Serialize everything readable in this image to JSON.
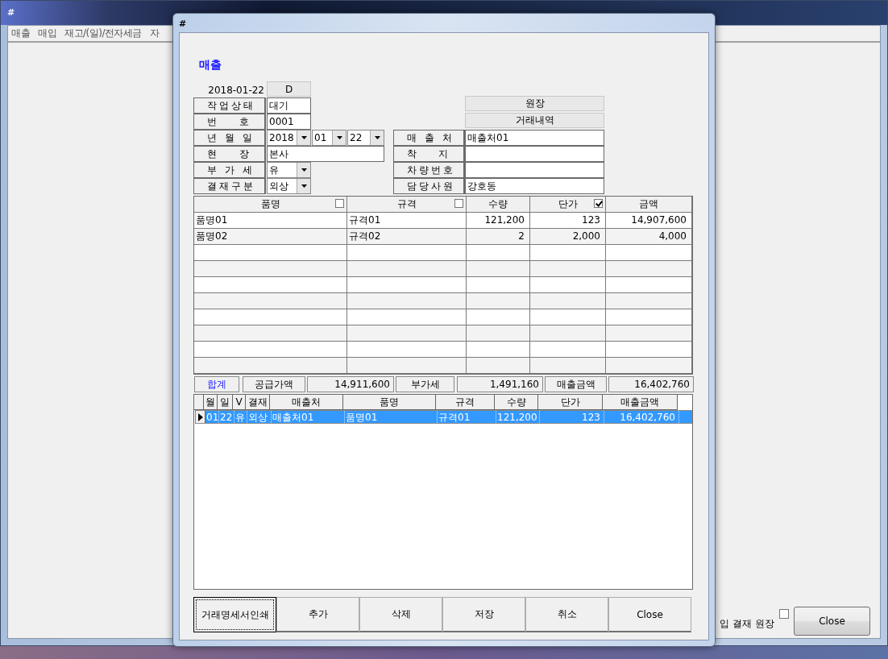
{
  "main_window": {
    "title": "#",
    "menu": [
      "매출",
      "매입",
      "재고/(일)/전자세금",
      "자"
    ],
    "option_label": "입 결재 원장",
    "option_checked": false,
    "close_button": "Close"
  },
  "dialog": {
    "title": "#",
    "heading": "매출",
    "date": "2018-01-22",
    "date_button": "D",
    "left_fields": [
      {
        "label": "작업상태",
        "kind": "text",
        "value": "대기"
      },
      {
        "label": "번 호",
        "kind": "text",
        "value": "0001"
      },
      {
        "label": "년 월 일",
        "kind": "date",
        "parts": [
          "2018",
          "01",
          "22"
        ]
      },
      {
        "label": "현 장",
        "kind": "wide",
        "value": "본사"
      },
      {
        "label": "부 가 세",
        "kind": "select",
        "value": "유"
      },
      {
        "label": "결재구분",
        "kind": "select",
        "value": "외상"
      }
    ],
    "right_buttons": [
      "원장",
      "거래내역"
    ],
    "right_fields": [
      {
        "label": "매 출 처",
        "value": "매출처01"
      },
      {
        "label": "착 지"
      },
      {
        "label": "차량번호"
      },
      {
        "label": "담당사원",
        "value": "강호동"
      }
    ],
    "grid": {
      "columns": [
        {
          "label": "품명",
          "kind": "check",
          "checked": false
        },
        {
          "label": "규격",
          "kind": "check",
          "checked": false
        },
        {
          "label": "수량",
          "kind": "plain"
        },
        {
          "label": "단가",
          "kind": "check",
          "checked": true
        },
        {
          "label": "금액",
          "kind": "plain"
        }
      ],
      "rows": [
        [
          "품명01",
          "규격01",
          "121,200",
          "123",
          "14,907,600"
        ],
        [
          "품명02",
          "규격02",
          "2",
          "2,000",
          "4,000"
        ]
      ]
    },
    "totals": {
      "label": "합계",
      "items": [
        {
          "label": "공급가액",
          "value": "14,911,600"
        },
        {
          "label": "부가세",
          "value": "1,491,160"
        },
        {
          "label": "매출금액",
          "value": "16,402,760"
        }
      ]
    },
    "list": {
      "columns": [
        "월",
        "일",
        "V",
        "결재",
        "매출처",
        "품명",
        "규격",
        "수량",
        "단가",
        "매출금액"
      ],
      "rows": [
        {
          "selected": true,
          "cells": [
            "01",
            "22",
            "유",
            "외상",
            "매출처01",
            "품명01",
            "규격01",
            "121,200",
            "123",
            "16,402,760"
          ]
        }
      ]
    },
    "buttons": [
      {
        "label": "거래명세서인쇄",
        "focused": true
      },
      {
        "label": "추가",
        "focused": false
      },
      {
        "label": "삭제",
        "focused": false
      },
      {
        "label": "저장",
        "focused": false
      },
      {
        "label": "취소",
        "focused": false
      },
      {
        "label": "Close",
        "focused": false
      }
    ]
  }
}
